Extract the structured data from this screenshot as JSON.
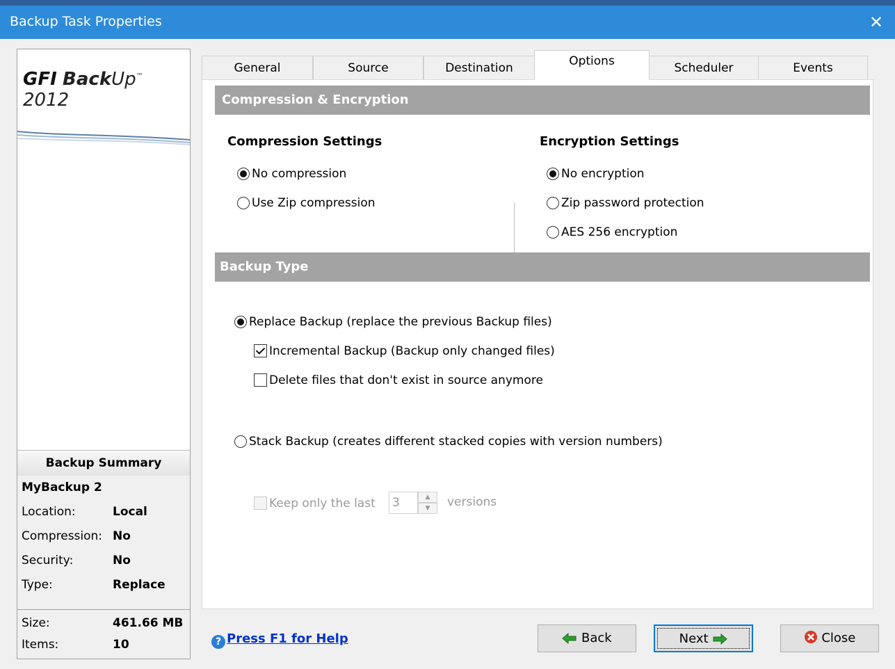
{
  "window": {
    "title": "Backup Task Properties",
    "close_glyph": "✕"
  },
  "logo": {
    "brand": "GFI",
    "name_bold": "Back",
    "name_italic": "Up",
    "tm": "™",
    "year": "2012"
  },
  "summary": {
    "header": "Backup Summary",
    "task_name": "MyBackup 2",
    "rows": [
      {
        "label": "Location:",
        "value": "Local"
      },
      {
        "label": "Compression:",
        "value": "No"
      },
      {
        "label": "Security:",
        "value": "No"
      },
      {
        "label": "Type:",
        "value": "Replace"
      }
    ],
    "stats": [
      {
        "label": "Size:",
        "value": "461.66 MB"
      },
      {
        "label": "Items:",
        "value": "10"
      }
    ]
  },
  "tabs": [
    {
      "label": "General",
      "active": false
    },
    {
      "label": "Source",
      "active": false
    },
    {
      "label": "Destination",
      "active": false
    },
    {
      "label": "Options",
      "active": true
    },
    {
      "label": "Scheduler",
      "active": false
    },
    {
      "label": "Events",
      "active": false
    }
  ],
  "options": {
    "compression_encryption_header": "Compression & Encryption",
    "compression": {
      "title": "Compression Settings",
      "choices": [
        {
          "label": "No compression",
          "checked": true
        },
        {
          "label": "Use Zip compression",
          "checked": false
        }
      ]
    },
    "encryption": {
      "title": "Encryption Settings",
      "choices": [
        {
          "label": "No encryption",
          "checked": true
        },
        {
          "label": "Zip password protection",
          "checked": false
        },
        {
          "label": "AES 256 encryption",
          "checked": false
        }
      ]
    },
    "backup_type_header": "Backup Type",
    "replace": {
      "label": "Replace Backup (replace the previous Backup files)",
      "checked": true,
      "incremental": {
        "label": "Incremental Backup (Backup only changed files)",
        "checked": true
      },
      "delete_missing": {
        "label": "Delete files that don't exist in source anymore",
        "checked": false
      }
    },
    "stack": {
      "label": "Stack Backup (creates different stacked copies with version numbers)",
      "checked": false,
      "keep_prefix": "Keep only the last",
      "keep_value": "3",
      "keep_suffix": "versions"
    }
  },
  "footer": {
    "help_icon": "?",
    "help_text": "Press F1 for Help",
    "back_label": "Back",
    "next_label": "Next",
    "close_label": "Close"
  },
  "colors": {
    "titlebar": "#2d8bd9",
    "section_bar": "#a3a3a3",
    "link": "#0033cc",
    "arrow_green": "#2e9e2e",
    "close_red": "#d63a2a"
  }
}
